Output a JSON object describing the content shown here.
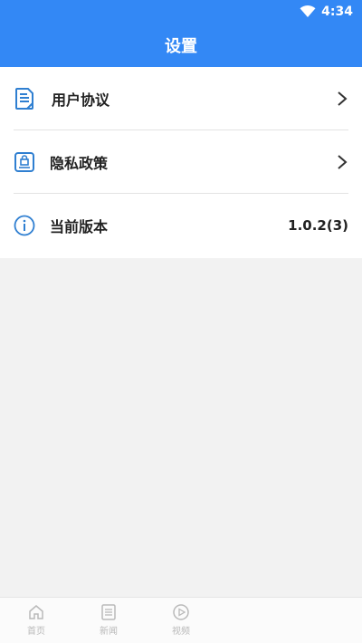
{
  "status_bar": {
    "time": "4:34"
  },
  "header": {
    "title": "设置"
  },
  "menu": {
    "items": [
      {
        "label": "用户协议",
        "icon": "document-icon"
      },
      {
        "label": "隐私政策",
        "icon": "privacy-lock-icon"
      },
      {
        "label": "当前版本",
        "icon": "info-icon",
        "value": "1.0.2(3)"
      }
    ]
  },
  "tabbar": {
    "tabs": [
      {
        "label": "首页",
        "icon": "home-icon"
      },
      {
        "label": "新闻",
        "icon": "news-icon"
      },
      {
        "label": "视频",
        "icon": "play-icon"
      }
    ]
  },
  "colors": {
    "primary": "#3388f5",
    "icon_blue": "#2f7fd1",
    "tab_inactive": "#b9b9b9"
  }
}
